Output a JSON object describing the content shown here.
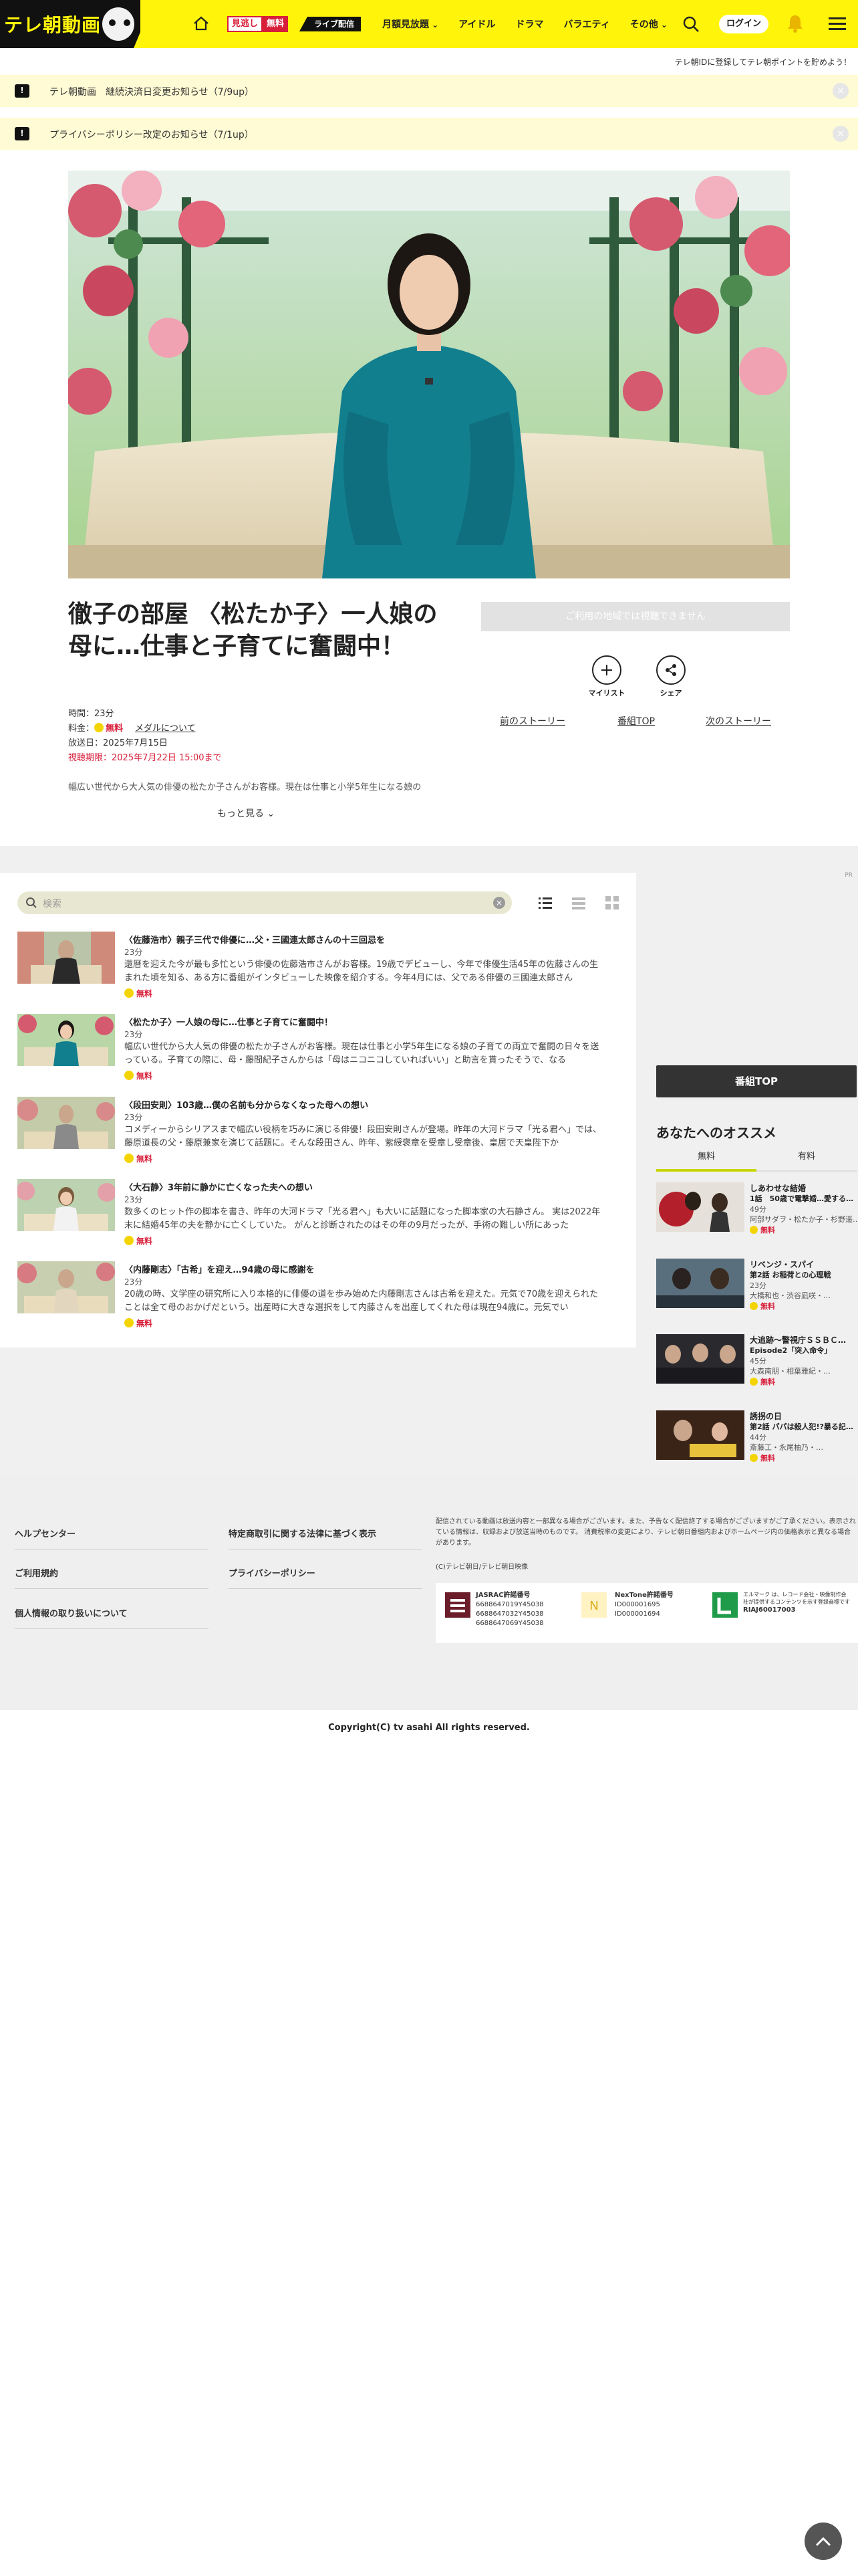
{
  "header": {
    "logo": "テレ朝動画",
    "mitai_a": "見逃し",
    "mitai_b": "無料",
    "live": "ライブ配信",
    "nav": [
      "月額見放題",
      "アイドル",
      "ドラマ",
      "バラエティ",
      "その他"
    ],
    "login": "ログイン",
    "accent": "#fff40a"
  },
  "promo_line": "テレ朝IDに登録してテレ朝ポイントを貯めよう！",
  "notices": [
    {
      "text": "テレ朝動画　継続決済日変更お知らせ（7/9up）"
    },
    {
      "text": "プライバシーポリシー改定のお知らせ（7/1up）"
    }
  ],
  "episode": {
    "title": "徹子の部屋 〈松たか子〉一人娘の母に…仕事と子育てに奮闘中！",
    "duration": "時間：23分",
    "price_label": "料金：",
    "price": "無料",
    "medal": "メダルについて",
    "aired": "放送日：2025年7月15日",
    "deadline": "視聴期限：2025年7月22日 15:00まで",
    "desc": "幅広い世代から大人気の俳優の松たか子さんがお客様。現在は仕事と小学5年生になる娘の",
    "more": "もっと見る",
    "region": "ご利用の地域では視聴できません",
    "mylist": "マイリスト",
    "share": "シェア",
    "prev": "前のストーリー",
    "top": "番組TOP",
    "next": "次のストーリー"
  },
  "list": {
    "search_placeholder": "検索",
    "pr": "PR",
    "items": [
      {
        "title": "〈佐藤浩市〉親子三代で俳優に…父・三國連太郎さんの十三回忌を",
        "dur": "23分",
        "desc": "還暦を迎えた今が最も多忙という俳優の佐藤浩市さんがお客様。19歳でデビューし、今年で俳優生活45年の佐藤さんの生まれた頃を知る、ある方に番組がインタビューした映像を紹介する。今年4月には、父である俳優の三國連太郎さん",
        "free": "無料"
      },
      {
        "title": "〈松たか子〉一人娘の母に…仕事と子育てに奮闘中！",
        "dur": "23分",
        "desc": "幅広い世代から大人気の俳優の松たか子さんがお客様。現在は仕事と小学5年生になる娘の子育ての両立で奮闘の日々を送っている。子育ての際に、母・藤間紀子さんからは「母はニコニコしていればいい」と助言を貰ったそうで、なる",
        "free": "無料"
      },
      {
        "title": "〈段田安則〉103歳…僕の名前も分からなくなった母への想い",
        "dur": "23分",
        "desc": "コメディーからシリアスまで幅広い役柄を巧みに演じる俳優！段田安則さんが登場。昨年の大河ドラマ「光る君へ」では、藤原道長の父・藤原兼家を演じて話題に。そんな段田さん、昨年、紫綬褒章を受章し受章後、皇居で天皇陛下か",
        "free": "無料"
      },
      {
        "title": "〈大石静〉3年前に静かに亡くなった夫への想い",
        "dur": "23分",
        "desc": "数多くのヒット作の脚本を書き、昨年の大河ドラマ「光る君へ」も大いに話題になった脚本家の大石静さん。 実は2022年末に結婚45年の夫を静かに亡くしていた。 がんと診断されたのはその年の9月だったが、手術の難しい所にあった",
        "free": "無料"
      },
      {
        "title": "〈内藤剛志〉「古希」を迎え…94歳の母に感謝を",
        "dur": "23分",
        "desc": "20歳の時、文学座の研究所に入り本格的に俳優の道を歩み始めた内藤剛志さんは古希を迎えた。元気で70歳を迎えられたことは全て母のおかげだという。出産時に大きな選択をして内藤さんを出産してくれた母は現在94歳に。元気でい",
        "free": "無料"
      }
    ]
  },
  "side": {
    "program_top": "番組TOP",
    "rec_title": "あなたへのオススメ",
    "tab_free": "無料",
    "tab_paid": "有料",
    "items": [
      {
        "t1": "しあわせな結婚",
        "t2": "1話　50歳で電撃婚…愛する…",
        "dur": "49分",
        "cast": "阿部サダヲ・松たか子・杉野遥…",
        "free": "無料"
      },
      {
        "t1": "リベンジ・スパイ",
        "t2": "第2話 お稲荷との心理戦",
        "dur": "23分",
        "cast": "大橋和也・渋谷凪咲・…",
        "free": "無料"
      },
      {
        "t1": "大追跡～警視庁ＳＳＢＣ…",
        "t2": "Episode2「突入命令」",
        "dur": "45分",
        "cast": "大森南朋・相葉雅紀・…",
        "free": "無料"
      },
      {
        "t1": "誘拐の日",
        "t2": "第2話 パパは殺人犯!?暴る記…",
        "dur": "44分",
        "cast": "斎藤工・永尾柚乃・…",
        "free": "無料"
      }
    ]
  },
  "footer": {
    "links_left": [
      "ヘルプセンター",
      "ご利用規約",
      "個人情報の取り扱いについて"
    ],
    "links_mid": [
      "特定商取引に関する法律に基づく表示",
      "プライバシーポリシー"
    ],
    "note": "配信されている動画は放送内容と一部異なる場合がございます。また、予告なく配信終了する場合がございますがご了承ください。表示されている情報は、収録および放送当時のものです。 消費税率の変更により、テレビ朝日番組内およびホームページ内の価格表示と異なる場合があります。",
    "copy2": "(C)テレビ朝日/テレビ朝日映像",
    "jasrac_title": "JASRAC許諾番号",
    "jasrac": [
      "6688647019Y45038",
      "6688647032Y45038",
      "6688647069Y45038"
    ],
    "nextone_title": "NexTone許諾番号",
    "nextone": [
      "ID000001695",
      "ID000001694"
    ],
    "riaj_text": "エルマーク は、レコード会社・映像制作会社が提供するコンテンツを示す登録商標です",
    "riaj": "RIAJ60017003",
    "copyright": "Copyright(C) tv asahi All rights reserved."
  }
}
